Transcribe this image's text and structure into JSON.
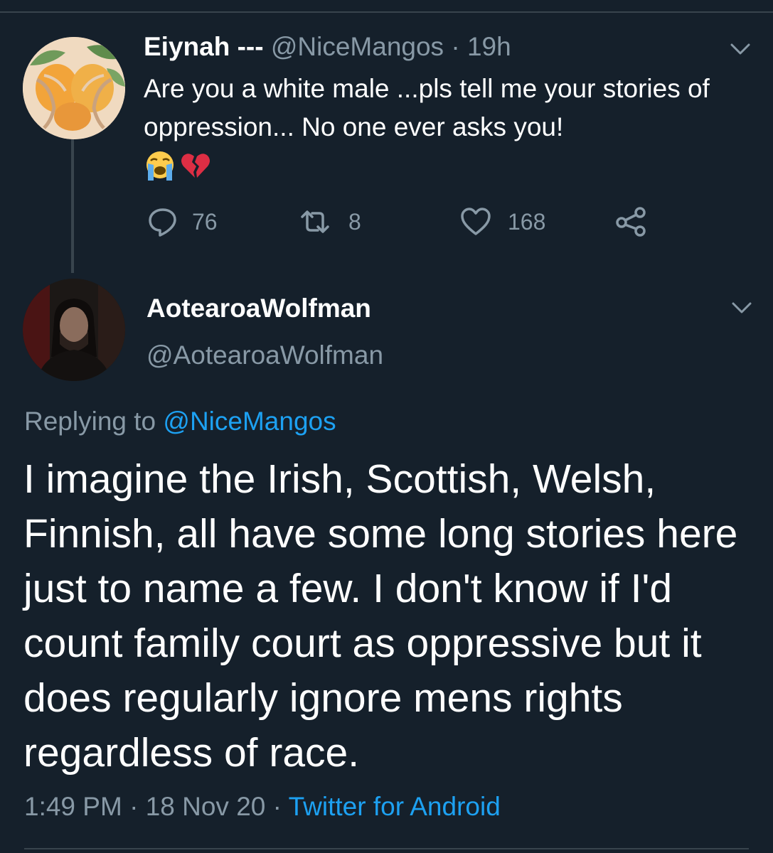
{
  "parent_tweet": {
    "display_name": "Eiynah ---",
    "handle": "@NiceMangos",
    "separator": "·",
    "time_ago": "19h",
    "text": "Are you a white male ...pls tell me your stories of oppression... No one ever asks you!",
    "emojis": [
      "loudly-crying-face",
      "broken-heart"
    ],
    "reply_count": "76",
    "retweet_count": "8",
    "like_count": "168"
  },
  "reply_tweet": {
    "display_name": "AotearoaWolfman",
    "handle": "@AotearoaWolfman",
    "replying_prefix": "Replying to",
    "replying_to": "@NiceMangos",
    "text": "I imagine the Irish, Scottish, Welsh, Finnish, all have some long stories here just to name a few. I don't know if I'd count family court as oppressive but it does regularly ignore mens rights regardless of race.",
    "time": "1:49 PM",
    "separator": "·",
    "date": "18 Nov 20",
    "source": "Twitter for Android"
  },
  "colors": {
    "background": "#15202b",
    "text": "#ffffff",
    "muted": "#8899a6",
    "link": "#1da1f2",
    "divider": "#38444d"
  },
  "icons": [
    "chevron-down-icon",
    "reply-icon",
    "retweet-icon",
    "like-icon",
    "share-icon"
  ]
}
